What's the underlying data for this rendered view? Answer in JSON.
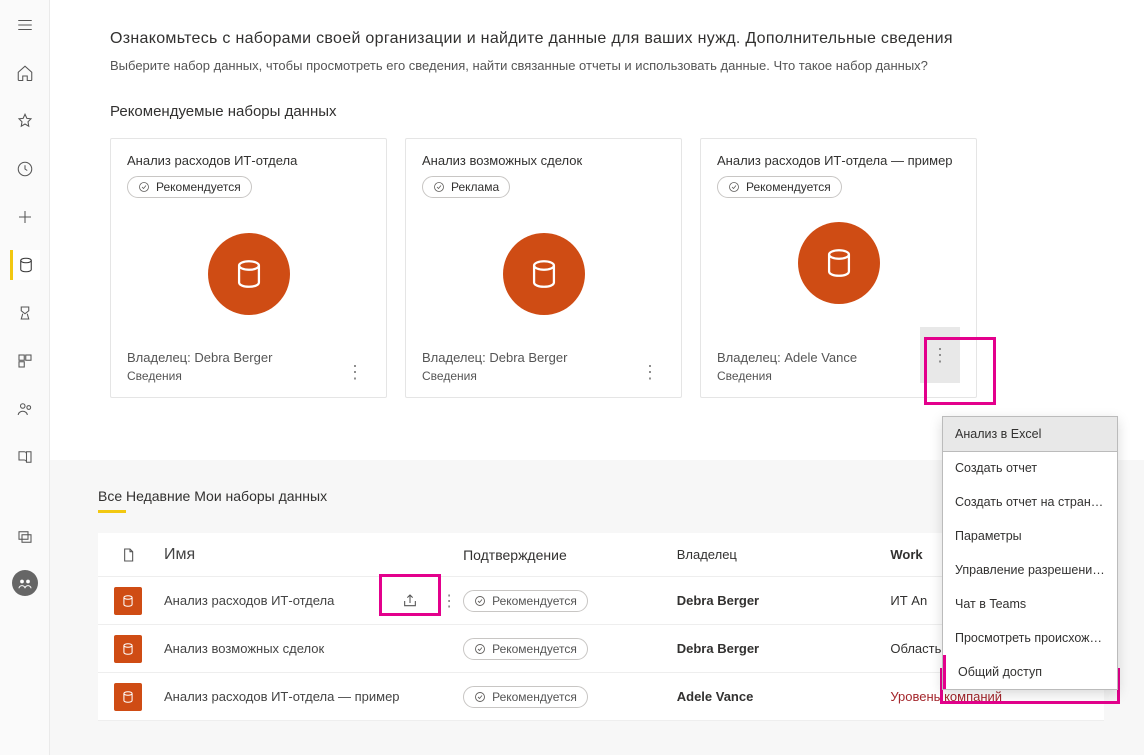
{
  "intro": "Ознакомьтесь с наборами своей организации и найдите данные для ваших нужд. Дополнительные сведения",
  "subintro": "Выберите набор данных, чтобы просмотреть его сведения, найти связанные отчеты и использовать данные. Что такое набор данных?",
  "section_header": "Рекомендуемые наборы данных",
  "badge_recommended": "Рекомендуется",
  "badge_promo": "Реклама",
  "owner_label_prefix": "Владелец: ",
  "details_label": "Сведения",
  "cards": [
    {
      "title": "Анализ расходов ИТ-отдела",
      "badge": "Рекомендуется",
      "owner": "Debra Berger"
    },
    {
      "title": "Анализ возможных сделок",
      "badge": "Реклама",
      "owner": "Debra Berger"
    },
    {
      "title": "Анализ расходов ИТ-отдела — пример",
      "badge": "Рекомендуется",
      "owner": "Adele Vance"
    }
  ],
  "tabs_label": "Все Недавние Мои наборы данных",
  "columns": {
    "name": "Имя",
    "confirmation": "Подтверждение",
    "owner": "Владелец",
    "workspace": "Work"
  },
  "rows": [
    {
      "name": "Анализ расходов ИТ-отдела",
      "conf": "Рекомендуется",
      "owner": "Debra Berger",
      "ws": "ИТ An",
      "share": true
    },
    {
      "name": "Анализ возможных сделок",
      "conf": "Рекомендуется",
      "owner": "Debra Berger",
      "ws": "Область ИТ",
      "share": false
    },
    {
      "name": "Анализ расходов ИТ-отдела — пример",
      "conf": "Рекомендуется",
      "owner": "Adele Vance",
      "ws": "Уровень компаний",
      "share": false,
      "ws_red": true
    }
  ],
  "menu": {
    "items": [
      "Анализ в Excel",
      "Создать отчет",
      "Создать отчет на страницу",
      "Параметры",
      "Управление разрешениями",
      "Чат в Teams",
      "Просмотреть происхождение",
      "Общий доступ"
    ]
  }
}
